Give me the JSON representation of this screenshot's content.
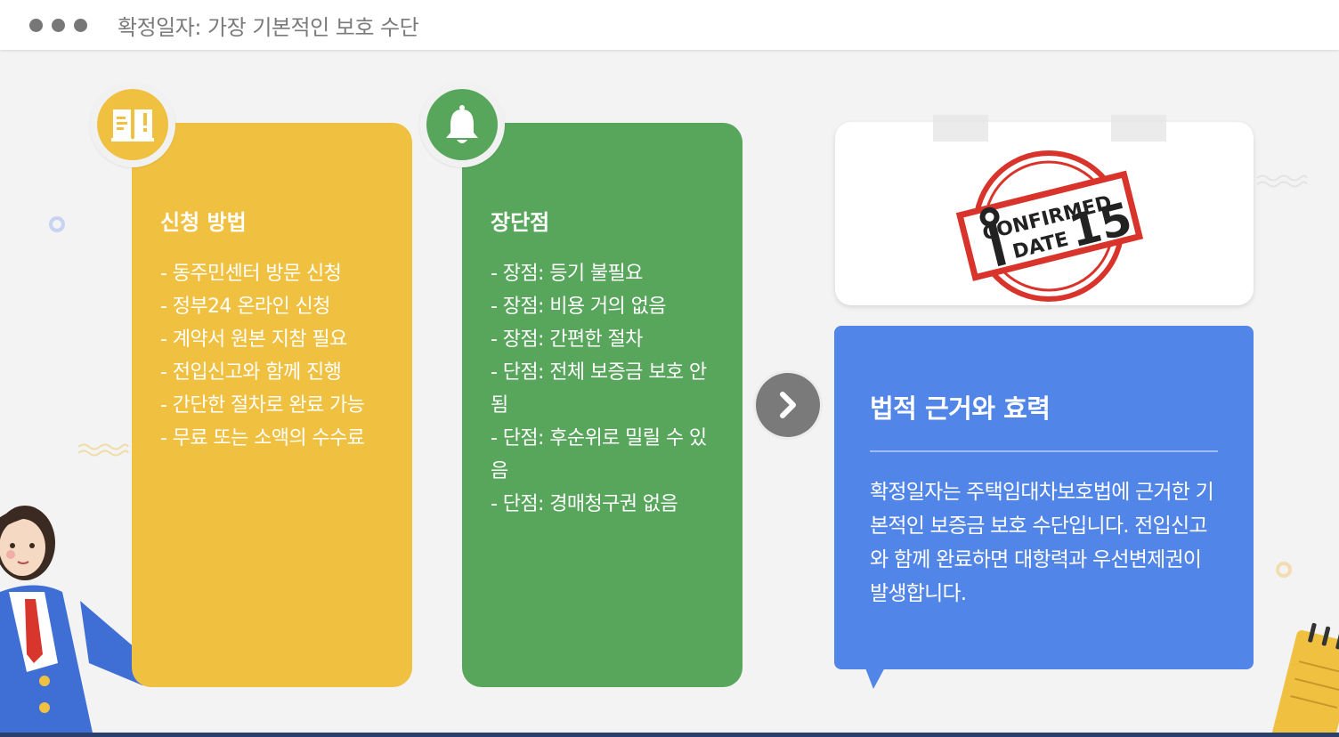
{
  "header": {
    "title": "확정일자: 가장 기본적인 보호 수단"
  },
  "cards": {
    "application": {
      "title": "신청 방법",
      "items": [
        "- 동주민센터 방문 신청",
        "- 정부24 온라인 신청",
        "- 계약서 원본 지참 필요",
        "- 전입신고와 함께 진행",
        "- 간단한 절차로 완료 가능",
        "- 무료 또는 소액의 수수료"
      ]
    },
    "pros_cons": {
      "title": "장단점",
      "items": [
        "- 장점: 등기 불필요",
        "- 장점: 비용 거의 없음",
        "- 장점: 간편한 절차",
        "- 단점: 전체 보증금 보호 안됨",
        "- 단점: 후순위로 밀릴 수 있음",
        "- 단점: 경매청구권 없음"
      ]
    },
    "legal": {
      "title": "법적 근거와 효력",
      "body": "확정일자는 주택임대차보호법에 근거한 기본적인 보증금 보호 수단입니다. 전입신고와 함께 완료하면 대항력과 우선변제권이 발생합니다."
    }
  },
  "stamp": {
    "line1": "CONFIRMED",
    "line2": "DATE",
    "number": "15"
  },
  "icons": {
    "badge_left": "book-icon",
    "badge_mid": "bell-icon",
    "next": "chevron-right-icon"
  },
  "colors": {
    "yellow": "#f0c041",
    "green": "#58a65c",
    "blue": "#5285e8",
    "stamp_red": "#d9342b"
  }
}
